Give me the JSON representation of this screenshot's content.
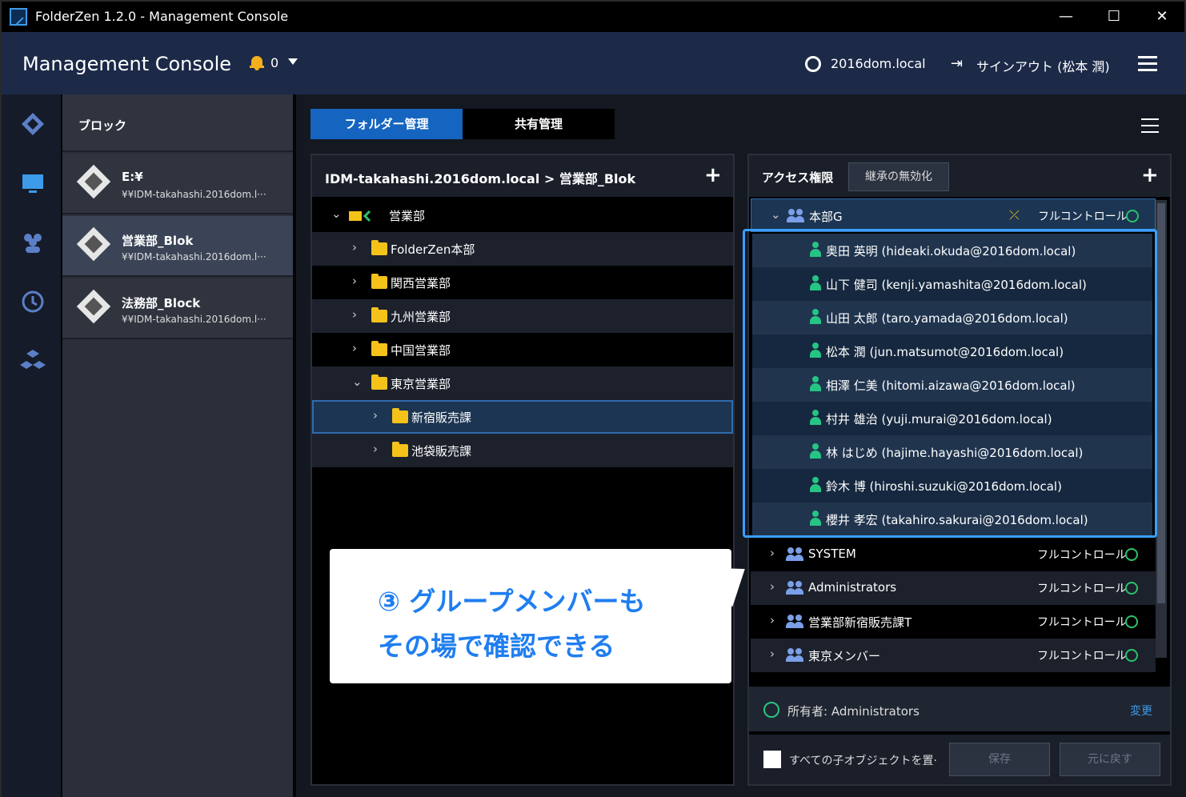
{
  "window": {
    "title": "FolderZen 1.2.0 - Management Console",
    "minimize": "—",
    "maximize": "☐",
    "close": "✕"
  },
  "header": {
    "app_title": "Management Console",
    "notification_count": "0",
    "domain": "2016dom.local",
    "signout": "サインアウト (松本 潤)"
  },
  "blocks": {
    "header": "ブロック",
    "items": [
      {
        "name": "E:¥",
        "path": "¥¥IDM-takahashi.2016dom.l···"
      },
      {
        "name": "営業部_Blok",
        "path": "¥¥IDM-takahashi.2016dom.l···"
      },
      {
        "name": "法務部_Block",
        "path": "¥¥IDM-takahashi.2016dom.l···"
      }
    ]
  },
  "tabs": {
    "folder": "フォルダー管理",
    "share": "共有管理"
  },
  "tree": {
    "path": "IDM-takahashi.2016dom.local > 営業部_Blok",
    "items": [
      {
        "label": "営業部",
        "chev": "⌄"
      },
      {
        "label": "FolderZen本部",
        "chev": "›"
      },
      {
        "label": "関西営業部",
        "chev": "›"
      },
      {
        "label": "九州営業部",
        "chev": "›"
      },
      {
        "label": "中国営業部",
        "chev": "›"
      },
      {
        "label": "東京営業部",
        "chev": "⌄"
      },
      {
        "label": "新宿販売課",
        "chev": "›"
      },
      {
        "label": "池袋販売課",
        "chev": "›"
      }
    ]
  },
  "acl": {
    "title": "アクセス権限",
    "inherit_button": "継承の無効化",
    "top_group": {
      "label": "本部G",
      "perm": "フルコントロール"
    },
    "members": [
      "奥田 英明 (hideaki.okuda@2016dom.local)",
      "山下 健司 (kenji.yamashita@2016dom.local)",
      "山田 太郎 (taro.yamada@2016dom.local)",
      "松本 潤 (jun.matsumot@2016dom.local)",
      "相澤 仁美 (hitomi.aizawa@2016dom.local)",
      "村井 雄治 (yuji.murai@2016dom.local)",
      "林 はじめ (hajime.hayashi@2016dom.local)",
      "鈴木 博 (hiroshi.suzuki@2016dom.local)",
      "櫻井 孝宏 (takahiro.sakurai@2016dom.local)"
    ],
    "groups": [
      {
        "label": "SYSTEM",
        "perm": "フルコントロール"
      },
      {
        "label": "Administrators",
        "perm": "フルコントロール"
      },
      {
        "label": "営業部新宿販売課T",
        "perm": "フルコントロール"
      },
      {
        "label": "東京メンバー",
        "perm": "フルコントロール"
      }
    ],
    "owner": "所有者: Administrators",
    "change": "変更",
    "replace_children": "すべての子オブジェクトを置···",
    "save": "保存",
    "revert": "元に戻す"
  },
  "callout": {
    "line1": "③ グループメンバーも",
    "line2": "その場で確認できる"
  }
}
